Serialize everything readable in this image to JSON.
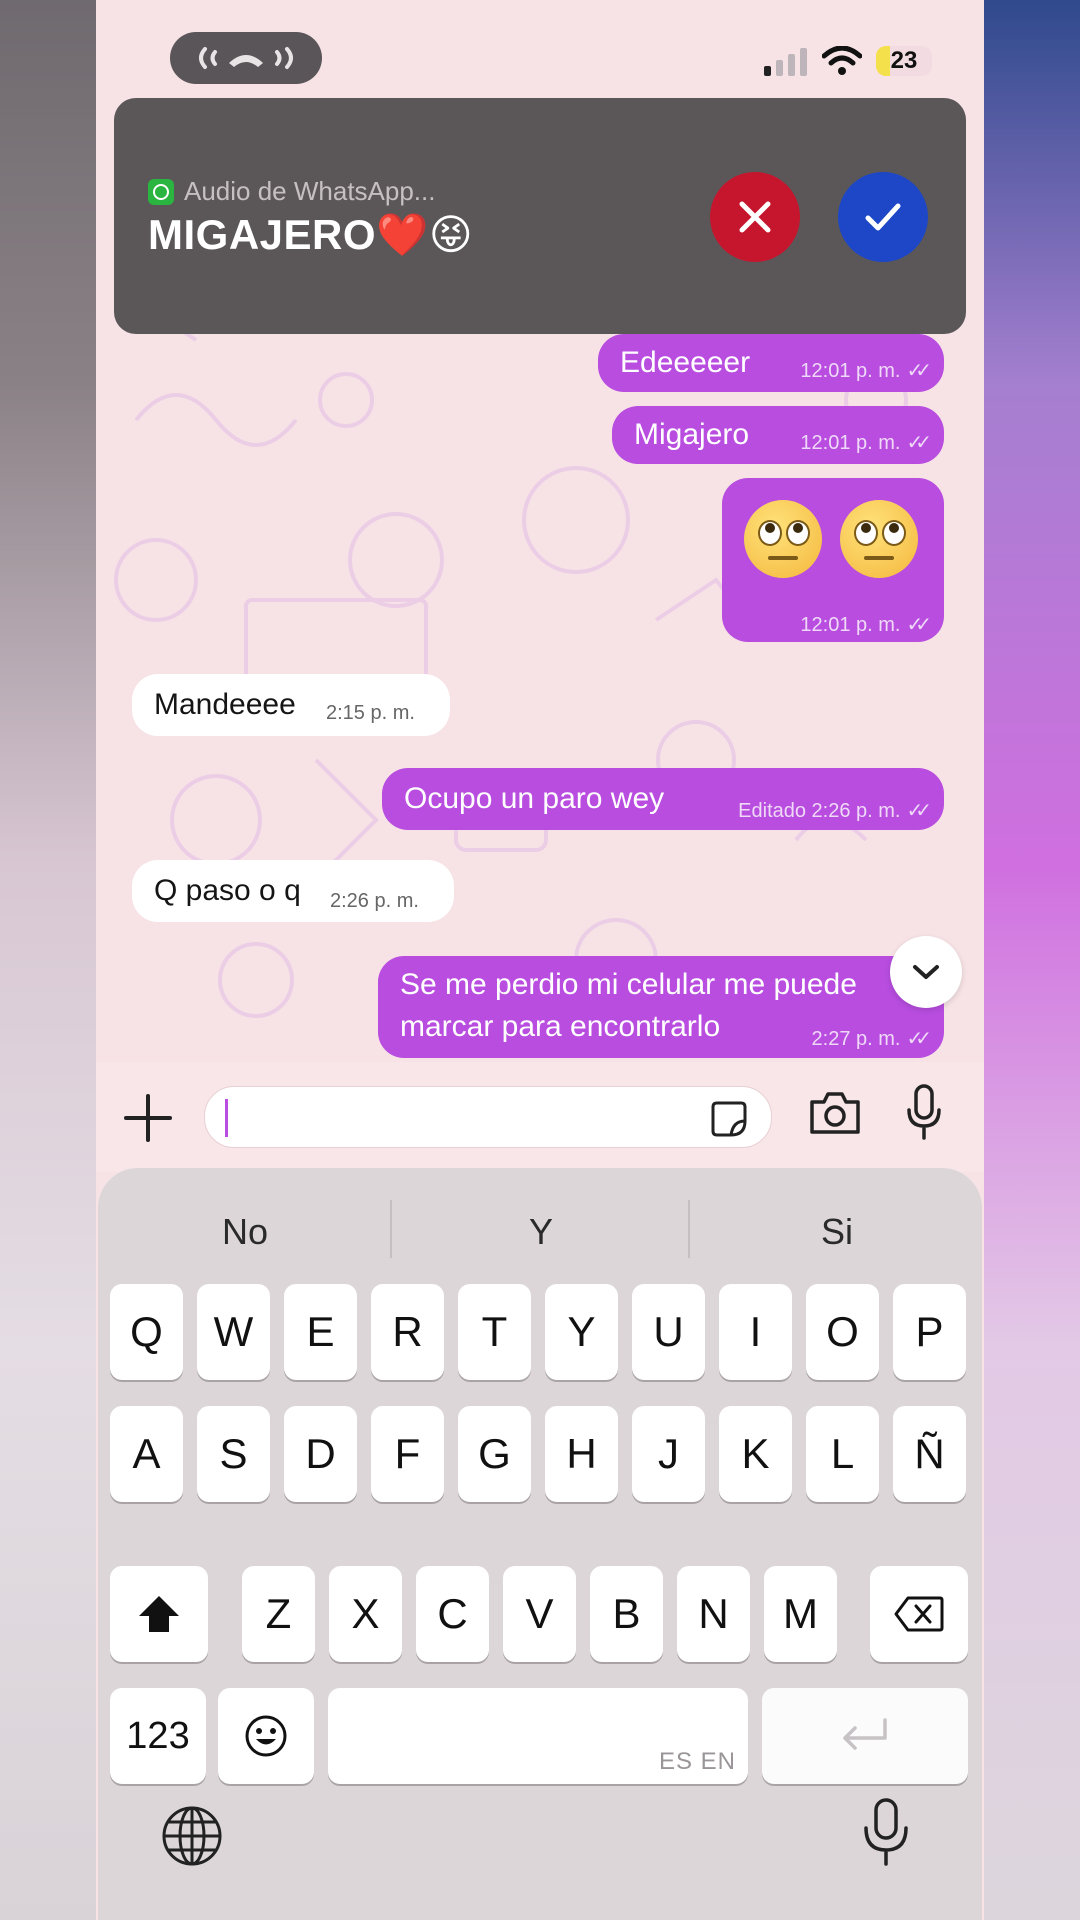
{
  "status_bar": {
    "battery": "23"
  },
  "call_banner": {
    "source": "Audio de WhatsApp...",
    "caller": "MIGAJERO❤️😝"
  },
  "messages": [
    {
      "direction": "out",
      "text": "Edeeeeer",
      "time": "12:01 p. m."
    },
    {
      "direction": "out",
      "text": "Migajero",
      "time": "12:01 p. m."
    },
    {
      "direction": "out",
      "text": "🙄🙄",
      "time": "12:01 p. m.",
      "kind": "emoji"
    },
    {
      "direction": "in",
      "text": "Mandeeee",
      "time": "2:15 p. m."
    },
    {
      "direction": "out",
      "text": "Ocupo un paro wey",
      "time": "Editado 2:26 p. m."
    },
    {
      "direction": "in",
      "text": "Q paso o q",
      "time": "2:26 p. m."
    },
    {
      "direction": "out",
      "text_line1": "Se me perdio mi celular me puede",
      "text_line2": "marcar para encontrarlo",
      "time": "2:27 p. m."
    }
  ],
  "composer": {
    "value": ""
  },
  "keyboard": {
    "suggestions": [
      "No",
      "Y",
      "Si"
    ],
    "row1": [
      "Q",
      "W",
      "E",
      "R",
      "T",
      "Y",
      "U",
      "I",
      "O",
      "P"
    ],
    "row2": [
      "A",
      "S",
      "D",
      "F",
      "G",
      "H",
      "J",
      "K",
      "L",
      "Ñ"
    ],
    "row3": [
      "Z",
      "X",
      "C",
      "V",
      "B",
      "N",
      "M"
    ],
    "numbers_key": "123",
    "language_label": "ES EN"
  },
  "colors": {
    "outgoing_bubble": "#b84de0",
    "incoming_bubble": "#ffffff",
    "decline": "#c6162e",
    "accept": "#1d47c6",
    "chat_background": "#f7e3e6"
  },
  "icons": [
    "call-in-progress-icon",
    "signal-icon",
    "wifi-icon",
    "whatsapp-icon",
    "close-icon",
    "check-icon",
    "double-check-icon",
    "chevron-down-icon",
    "plus-icon",
    "sticker-icon",
    "camera-icon",
    "microphone-icon",
    "shift-icon",
    "backspace-icon",
    "emoji-icon",
    "return-icon",
    "globe-icon",
    "dictation-icon"
  ]
}
